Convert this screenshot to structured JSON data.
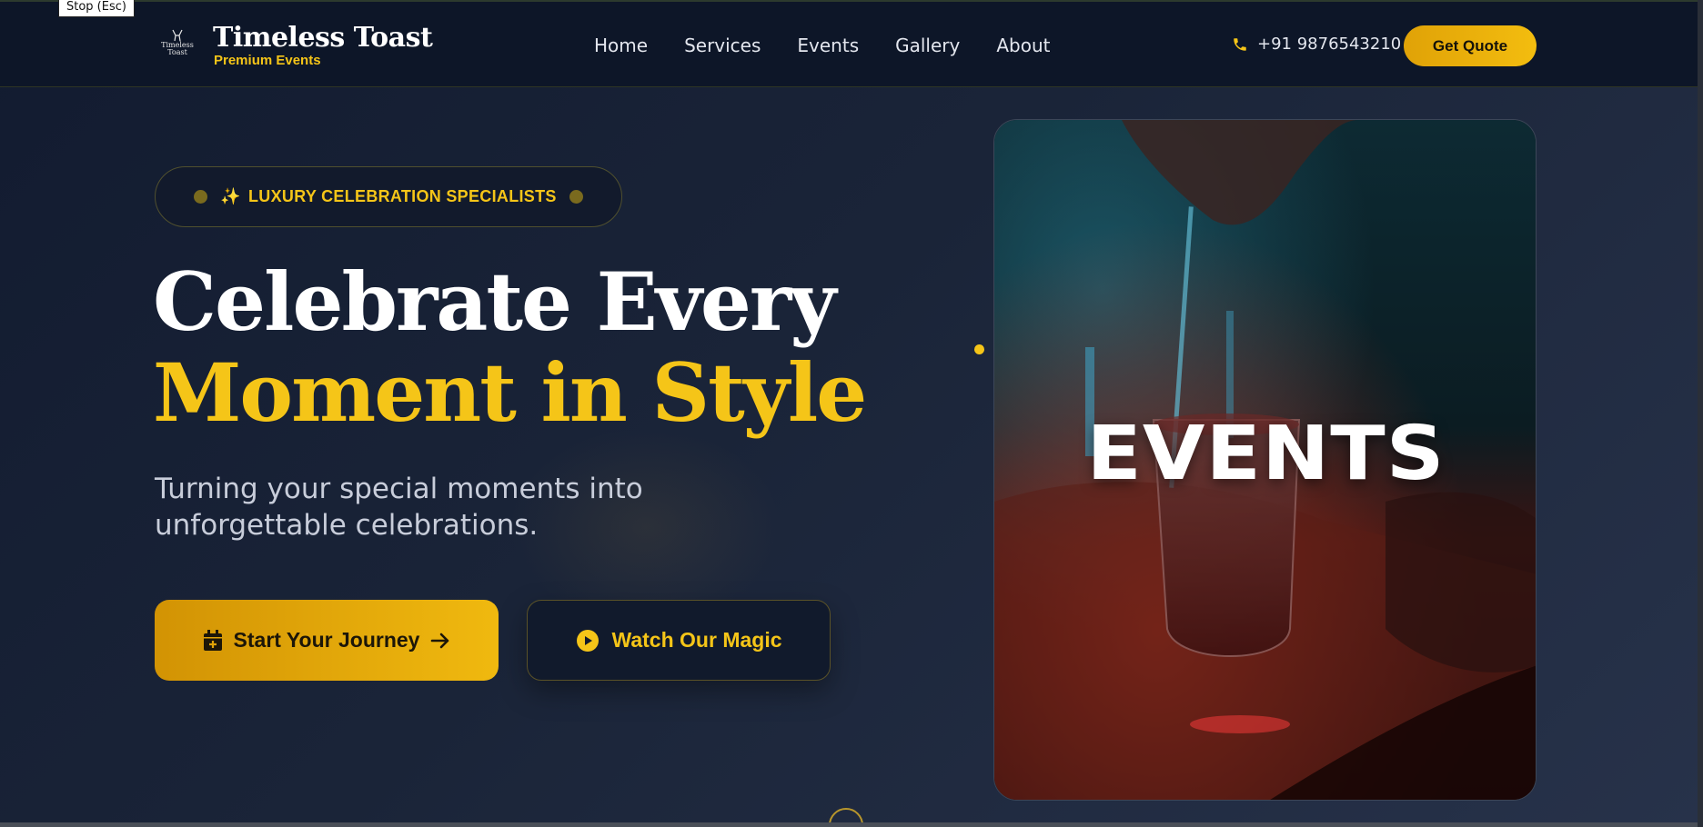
{
  "overlay": {
    "stop_label": "Stop (Esc)"
  },
  "brand": {
    "logo_text_1": "Timeless",
    "logo_text_2": "Toast",
    "name": "Timeless Toast",
    "tagline": "Premium Events"
  },
  "nav": {
    "items": [
      {
        "label": "Home"
      },
      {
        "label": "Services"
      },
      {
        "label": "Events"
      },
      {
        "label": "Gallery"
      },
      {
        "label": "About"
      }
    ]
  },
  "header": {
    "phone": "+91 9876543210",
    "quote_label": "Get Quote"
  },
  "hero": {
    "badge_icon": "✨",
    "badge_text": "LUXURY CELEBRATION SPECIALISTS",
    "headline_line1": "Celebrate Every",
    "headline_line2": "Moment in Style",
    "subtext": "Turning your special moments into unforgettable celebrations.",
    "primary_button": "Start Your Journey",
    "secondary_button": "Watch Our Magic"
  },
  "media": {
    "overlay_title": "EVENTS"
  },
  "colors": {
    "accent": "#f5c518",
    "background": "#121b30",
    "header_bg": "#0d1628"
  },
  "icons": {
    "phone": "phone-icon",
    "calendar": "calendar-plus-icon",
    "arrow": "arrow-right-icon",
    "play": "play-circle-icon",
    "sparkle": "sparkle-icon",
    "scroll": "scroll-down-icon"
  }
}
